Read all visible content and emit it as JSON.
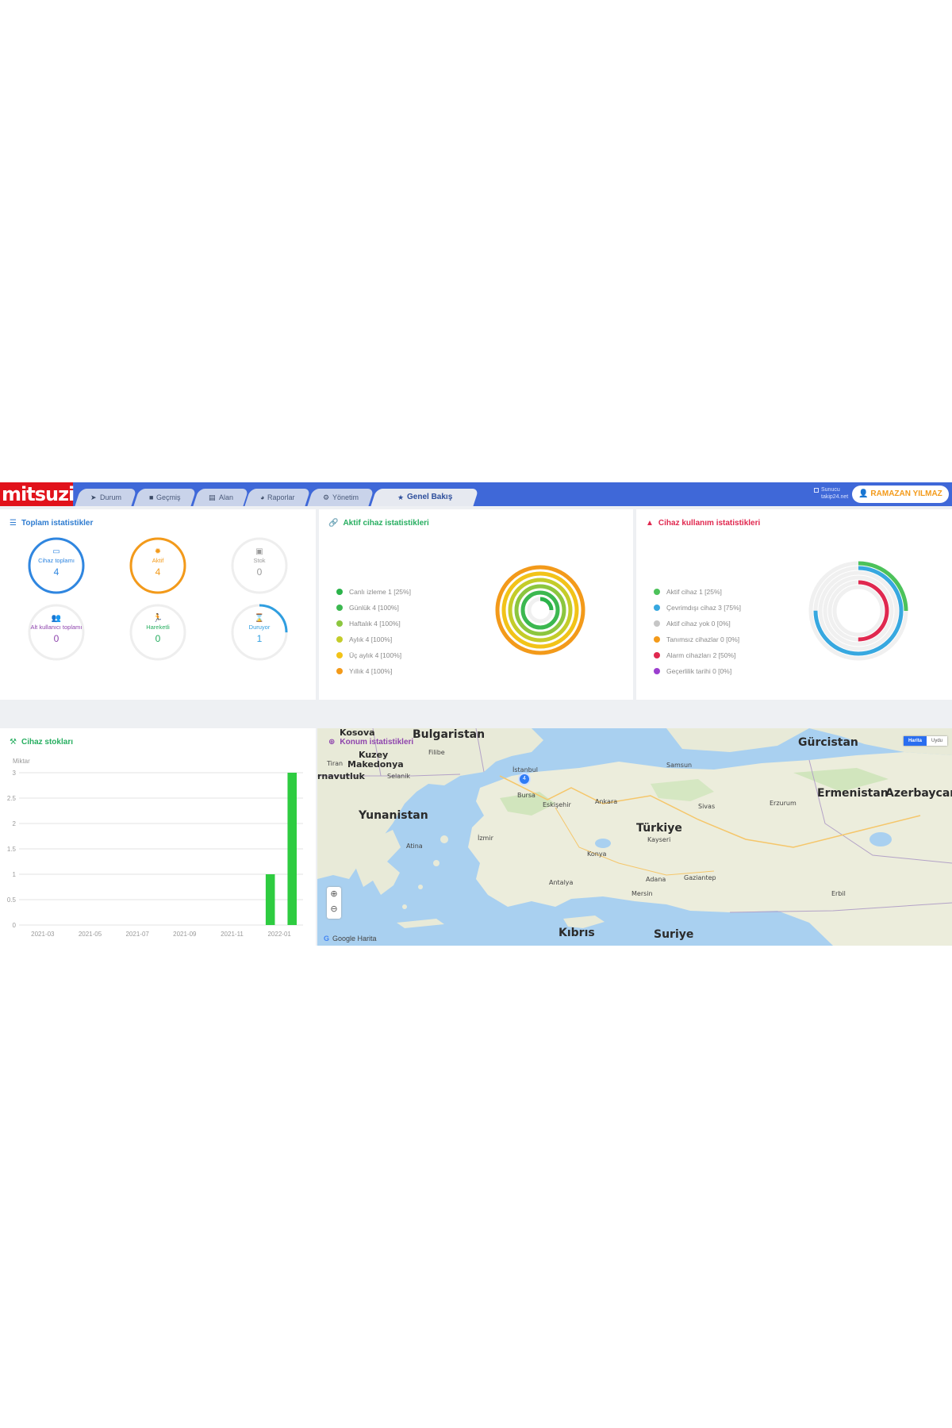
{
  "brand": {
    "logo_text": "mitsuzi"
  },
  "tabs": [
    {
      "label": "Durum",
      "icon": "send-icon"
    },
    {
      "label": "Geçmiş",
      "icon": "video-icon"
    },
    {
      "label": "Alan",
      "icon": "layers-icon"
    },
    {
      "label": "Raporlar",
      "icon": "chart-icon"
    },
    {
      "label": "Yönetim",
      "icon": "gear-icon"
    },
    {
      "label": "Genel Bakış",
      "icon": "star-icon",
      "active": true
    }
  ],
  "server": {
    "line1": "Sunucu",
    "line2": "takip24.net"
  },
  "user": {
    "name": "RAMAZAN YILMAZ"
  },
  "total_stats": {
    "title": "Toplam istatistikler",
    "items": [
      {
        "label": "Cihaz toplamı",
        "value": "4",
        "color": "#2f86e0"
      },
      {
        "label": "Aktif",
        "value": "4",
        "color": "#f39a1a"
      },
      {
        "label": "Stok",
        "value": "0",
        "color": "#9a9a9a"
      },
      {
        "label": "Alt kullanıcı toplamı",
        "value": "0",
        "color": "#8e44ad"
      },
      {
        "label": "Hareketli",
        "value": "0",
        "color": "#27ae60"
      },
      {
        "label": "Duruyor",
        "value": "1",
        "color": "#2f9ee0"
      }
    ]
  },
  "active_stats": {
    "title": "Aktif cihaz istatistikleri",
    "legend": [
      {
        "label": "Canlı izleme 1 [25%]",
        "color": "#2bb34a",
        "fraction": 0.25
      },
      {
        "label": "Günlük 4 [100%]",
        "color": "#3cb850",
        "fraction": 1
      },
      {
        "label": "Haftalık 4 [100%]",
        "color": "#8cc63f",
        "fraction": 1
      },
      {
        "label": "Aylık 4 [100%]",
        "color": "#c4cc2a",
        "fraction": 1
      },
      {
        "label": "Üç aylık 4 [100%]",
        "color": "#f2c318",
        "fraction": 1
      },
      {
        "label": "Yıllık 4 [100%]",
        "color": "#f39a1a",
        "fraction": 1
      }
    ]
  },
  "usage_stats": {
    "title": "Cihaz kullanım istatistikleri",
    "legend": [
      {
        "label": "Aktif cihaz 1 [25%]",
        "color": "#4cc25a",
        "fraction": 0.25
      },
      {
        "label": "Çevrimdışı cihaz 3 [75%]",
        "color": "#37a8e0",
        "fraction": 0.75
      },
      {
        "label": "Aktif cihaz yok 0 [0%]",
        "color": "#c6c6c6",
        "fraction": 0
      },
      {
        "label": "Tanımsız cihazlar 0 [0%]",
        "color": "#f39a1a",
        "fraction": 0
      },
      {
        "label": "Alarm cihazları 2 [50%]",
        "color": "#e0284f",
        "fraction": 0.5
      },
      {
        "label": "Geçerlilik tarihi 0 [0%]",
        "color": "#9b3fcf",
        "fraction": 0
      }
    ]
  },
  "stock": {
    "title": "Cihaz stokları"
  },
  "chart_data": {
    "type": "bar",
    "title": "Cihaz stokları",
    "ylabel": "Miktar",
    "ylim": [
      0,
      3
    ],
    "yticks": [
      "0",
      "0.5",
      "1",
      "1.5",
      "2",
      "2.5",
      "3"
    ],
    "xticks": [
      "2021-03",
      "2021-05",
      "2021-07",
      "2021-09",
      "2021-11",
      "2022-01"
    ],
    "series": [
      {
        "values": [
          0,
          0,
          0,
          0,
          0,
          0,
          0,
          0,
          0,
          0,
          0,
          1,
          3
        ]
      }
    ],
    "grid": true,
    "bar_color": "#2ecc40"
  },
  "map": {
    "title": "Konum istatistikleri",
    "map_type": {
      "map": "Harita",
      "satellite": "Uydu"
    },
    "attribution": "Google Harita",
    "marker_count": "4",
    "labels": {
      "kosova": "Kosova",
      "bulgaristan": "Bulgaristan",
      "gurcistan": "Gürcistan",
      "kuzey": "Kuzey",
      "makedonya": "Makedonya",
      "arnavutluk": "rnavutluk",
      "tiran": "Tiran",
      "filibe": "Filibe",
      "selanik": "Selanik",
      "ermenistan": "Ermenistan",
      "azerbaycan": "Azerbaycan",
      "yunanistan": "Yunanistan",
      "istanbul": "İstanbul",
      "bursa": "Bursa",
      "eskisehir": "Eskişehir",
      "ankara": "Ankara",
      "samsun": "Samsun",
      "sivas": "Sivas",
      "erzurum": "Erzurum",
      "turkiye": "Türkiye",
      "kayseri": "Kayseri",
      "konya": "Konya",
      "izmir": "İzmir",
      "antalya": "Antalya",
      "adana": "Adana",
      "mersin": "Mersin",
      "gaziantep": "Gaziantep",
      "atina": "Atina",
      "kibris": "Kıbrıs",
      "suriye": "Suriye",
      "erbil": "Erbil"
    }
  },
  "colors": {
    "topbar": "#3f68d8",
    "brand": "#e1121b",
    "accent": "#f39a1a"
  }
}
